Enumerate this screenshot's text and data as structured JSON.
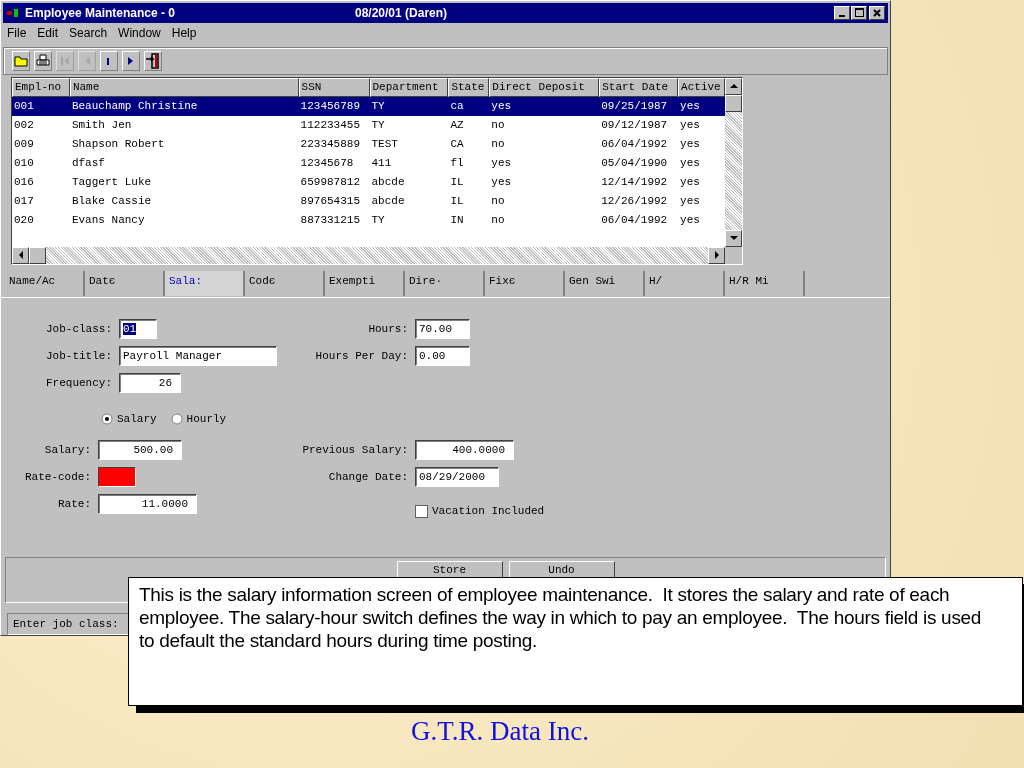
{
  "window": {
    "title": "Employee Maintenance - 0",
    "title_info": "08/20/01 (Daren)",
    "menu": [
      "File",
      "Edit",
      "Search",
      "Window",
      "Help"
    ],
    "toolbar": [
      {
        "kind": "open",
        "disabled": false
      },
      {
        "kind": "print",
        "disabled": false
      },
      {
        "kind": "first",
        "disabled": true
      },
      {
        "kind": "prev",
        "disabled": true
      },
      {
        "kind": "next",
        "disabled": false
      },
      {
        "kind": "last",
        "disabled": false
      },
      {
        "kind": "exit",
        "disabled": false
      }
    ]
  },
  "table": {
    "columns": [
      "Empl-no",
      "Name",
      "SSN",
      "Department",
      "State",
      "Direct Deposit",
      "Start Date",
      "Active"
    ],
    "rows": [
      {
        "selected": true,
        "cells": [
          "001",
          "Beauchamp Christine",
          "123456789",
          "TY",
          "ca",
          "yes",
          "09/25/1987",
          "yes"
        ]
      },
      {
        "selected": false,
        "cells": [
          "002",
          "Smith Jen",
          "112233455",
          "TY",
          "AZ",
          "no",
          "09/12/1987",
          "yes"
        ]
      },
      {
        "selected": false,
        "cells": [
          "009",
          "Shapson Robert",
          "223345889",
          "TEST",
          "CA",
          "no",
          "06/04/1992",
          "yes"
        ]
      },
      {
        "selected": false,
        "cells": [
          "010",
          "dfasf",
          "12345678",
          "411",
          "fl",
          "yes",
          "05/04/1990",
          "yes"
        ]
      },
      {
        "selected": false,
        "cells": [
          "016",
          "Taggert Luke",
          "659987812",
          "abcde",
          "IL",
          "yes",
          "12/14/1992",
          "yes"
        ]
      },
      {
        "selected": false,
        "cells": [
          "017",
          "Blake Cassie",
          "897654315",
          "abcde",
          "IL",
          "no",
          "12/26/1992",
          "yes"
        ]
      },
      {
        "selected": false,
        "cells": [
          "020",
          "Evans Nancy",
          "887331215",
          "TY",
          "IN",
          "no",
          "06/04/1992",
          "yes"
        ]
      }
    ]
  },
  "tabs": [
    {
      "label": "Name/Aс",
      "selected": false
    },
    {
      "label": "Datє",
      "selected": false
    },
    {
      "label": "Sala:",
      "selected": true
    },
    {
      "label": "Codє",
      "selected": false
    },
    {
      "label": "Exempti",
      "selected": false
    },
    {
      "label": "Dire·",
      "selected": false
    },
    {
      "label": "Fixє",
      "selected": false
    },
    {
      "label": "Gen Swi",
      "selected": false
    },
    {
      "label": "H/",
      "selected": false
    },
    {
      "label": "H/R Mi",
      "selected": false
    }
  ],
  "form": {
    "top_rows": [
      {
        "left": {
          "label": "Job-class:",
          "value": "01",
          "text_selected": true
        },
        "right": {
          "label": "Hours:",
          "value": "70.00"
        }
      },
      {
        "left": {
          "label": "Job-title:",
          "value": "Payroll Manager"
        },
        "right": {
          "label": "Hours Per Day:",
          "value": "0.00"
        }
      },
      {
        "left": {
          "label": "Frequency:",
          "value": "26"
        }
      }
    ],
    "pay_type": [
      {
        "label": "Salary",
        "selected": true
      },
      {
        "label": "Hourly",
        "selected": false
      }
    ],
    "salary": {
      "label": "Salary:",
      "value": "500.00"
    },
    "rate_code": {
      "label": "Rate-code:",
      "color": "#ff0000"
    },
    "rate": {
      "label": "Rate:",
      "value": "11.0000"
    },
    "previous_salary": {
      "label": "Previous Salary:",
      "value": "400.0000"
    },
    "change_date": {
      "label": "Change Date:",
      "value": "08/29/2000"
    },
    "vacation": {
      "label": "Vacation Included",
      "checked": false
    }
  },
  "buttons": [
    "Store",
    "Undo"
  ],
  "status_bar": "Enter job class:",
  "callout": "This is the salary information screen of employee maintenance.  It stores the salary and rate of each employee. The salary-hour switch defines the way in which to pay an employee.  The hours field is used to default the standard hours during time posting.",
  "footer": "G.T.R. Data Inc."
}
